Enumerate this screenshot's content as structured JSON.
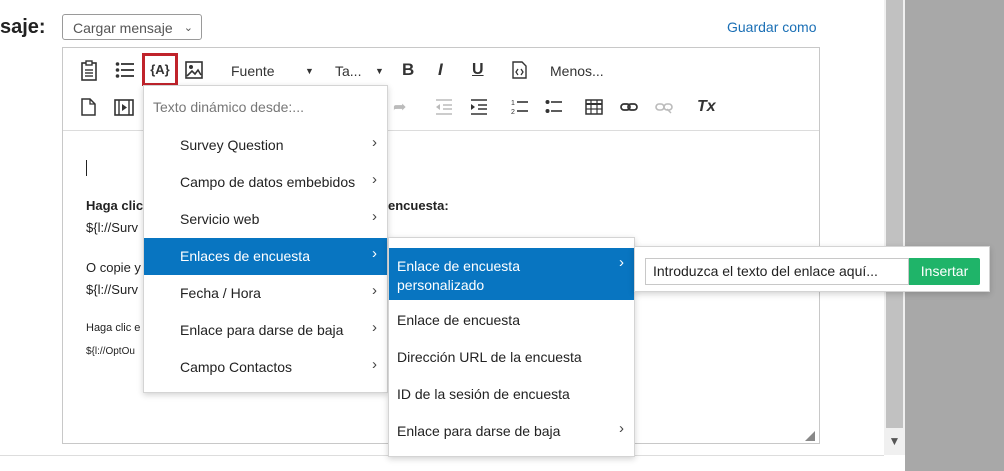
{
  "header": {
    "label": "saje:",
    "load_message": "Cargar mensaje",
    "save_as": "Guardar como"
  },
  "toolbar": {
    "font_label": "Fuente",
    "size_label": "Ta...",
    "bold": "B",
    "italic": "I",
    "underline": "U",
    "more_label": "Menos...",
    "dynamic_text_glyph": "{A}",
    "clear_format": "Tx"
  },
  "editor": {
    "line1_bold": "Haga clic",
    "line1_bold_end": "encuesta:",
    "line2": "${l://Surv",
    "line3": "O copie y",
    "line4": "${l://Surv",
    "line5": "Haga clic e",
    "line6": "${l://OptOu"
  },
  "dynamic_menu": {
    "heading": "Texto dinámico desde:...",
    "items": [
      {
        "label": "Survey Question"
      },
      {
        "label": "Campo de datos embebidos"
      },
      {
        "label": "Servicio web"
      },
      {
        "label": "Enlaces de encuesta"
      },
      {
        "label": "Fecha / Hora"
      },
      {
        "label": "Enlace para darse de baja"
      },
      {
        "label": "Campo Contactos"
      }
    ]
  },
  "survey_links_menu": {
    "items": [
      {
        "label_line1": "Enlace de encuesta",
        "label_line2": "personalizado"
      },
      {
        "label": "Enlace de encuesta"
      },
      {
        "label": "Dirección URL de la encuesta"
      },
      {
        "label": "ID de la sesión de encuesta"
      },
      {
        "label": "Enlace para darse de baja"
      }
    ]
  },
  "link_panel": {
    "input_value": "Introduzca el texto del enlace aquí...",
    "insert_label": "Insertar"
  },
  "colors": {
    "accent": "#0875c1",
    "insert_button": "#1fb469",
    "highlight_border": "#c0232b",
    "link": "#1a6fb5"
  }
}
